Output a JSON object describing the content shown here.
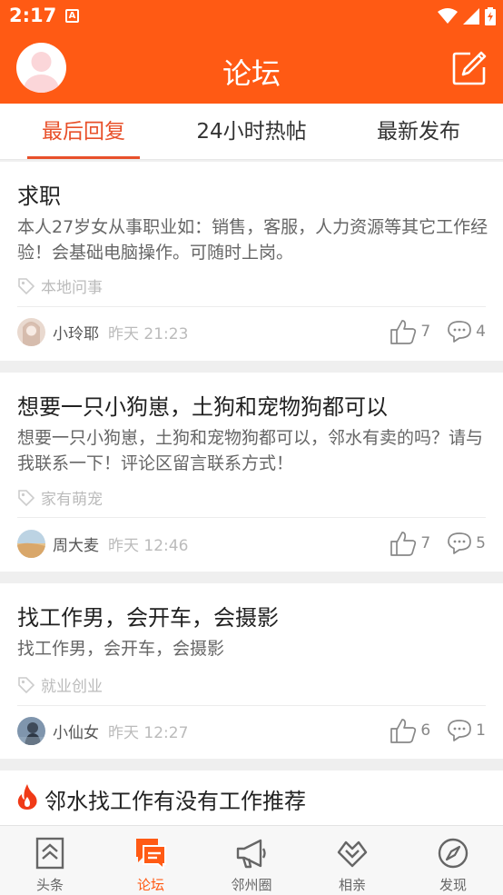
{
  "status": {
    "time": "2:17",
    "a_badge": "A"
  },
  "header": {
    "title": "论坛"
  },
  "tabs": [
    {
      "label": "最后回复",
      "active": true
    },
    {
      "label": "24小时热帖",
      "active": false
    },
    {
      "label": "最新发布",
      "active": false
    }
  ],
  "posts": [
    {
      "title": "求职",
      "body": "本人27岁女从事职业如：销售，客服，人力资源等其它工作经验！会基础电脑操作。可随时上岗。",
      "tag": "本地问事",
      "user": "小玲耶",
      "time": "昨天 21:23",
      "likes": "7",
      "comments": "4"
    },
    {
      "title": "想要一只小狗崽，土狗和宠物狗都可以",
      "body": "想要一只小狗崽，土狗和宠物狗都可以，邻水有卖的吗？请与我联系一下！评论区留言联系方式！",
      "tag": "家有萌宠",
      "user": "周大麦",
      "time": "昨天 12:46",
      "likes": "7",
      "comments": "5"
    },
    {
      "title": "找工作男，会开车，会摄影",
      "body": "找工作男，会开车，会摄影",
      "tag": "就业创业",
      "user": "小仙女",
      "time": "昨天 12:27",
      "likes": "6",
      "comments": "1"
    },
    {
      "title": "邻水找工作有没有工作推荐",
      "hot": true
    }
  ],
  "bottom_nav": [
    {
      "label": "头条",
      "icon": "headline-icon",
      "active": false
    },
    {
      "label": "论坛",
      "icon": "forum-icon",
      "active": true
    },
    {
      "label": "邻州圈",
      "icon": "megaphone-icon",
      "active": false
    },
    {
      "label": "相亲",
      "icon": "heart-icon",
      "active": false
    },
    {
      "label": "发现",
      "icon": "compass-icon",
      "active": false
    }
  ],
  "colors": {
    "brand": "#ff5a14",
    "active_tab": "#e8502a"
  }
}
